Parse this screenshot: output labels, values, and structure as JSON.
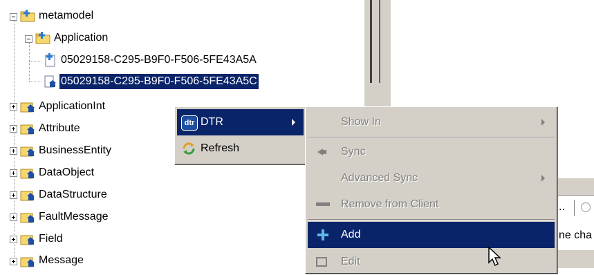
{
  "tree": {
    "root": {
      "label": "metamodel"
    },
    "application": {
      "label": "Application"
    },
    "children": [
      {
        "label": "05029158-C295-B9F0-F506-5FE43A5A"
      },
      {
        "label": "05029158-C295-B9F0-F506-5FE43A5C"
      }
    ],
    "nodes": [
      {
        "label": "ApplicationInt"
      },
      {
        "label": "Attribute"
      },
      {
        "label": "BusinessEntity"
      },
      {
        "label": "DataObject"
      },
      {
        "label": "DataStructure"
      },
      {
        "label": "FaultMessage"
      },
      {
        "label": "Field"
      },
      {
        "label": "Message"
      }
    ]
  },
  "context_menu": {
    "dtr": {
      "label": "DTR",
      "icon": "dtr-icon",
      "badge": "dtr"
    },
    "refresh": {
      "label": "Refresh",
      "icon": "refresh-icon"
    }
  },
  "submenu": {
    "show_in": {
      "label": "Show In"
    },
    "sync": {
      "label": "Sync"
    },
    "advanced_sync": {
      "label": "Advanced Sync"
    },
    "remove_from_client": {
      "label": "Remove from Client"
    },
    "add": {
      "label": "Add"
    },
    "edit": {
      "label": "Edit"
    }
  },
  "background": {
    "tab_fragment": "..",
    "text_fragment": "ne cha"
  },
  "colors": {
    "selection": "#0a246a",
    "menu_bg": "#d4d0c8",
    "disabled_text": "#808080"
  }
}
